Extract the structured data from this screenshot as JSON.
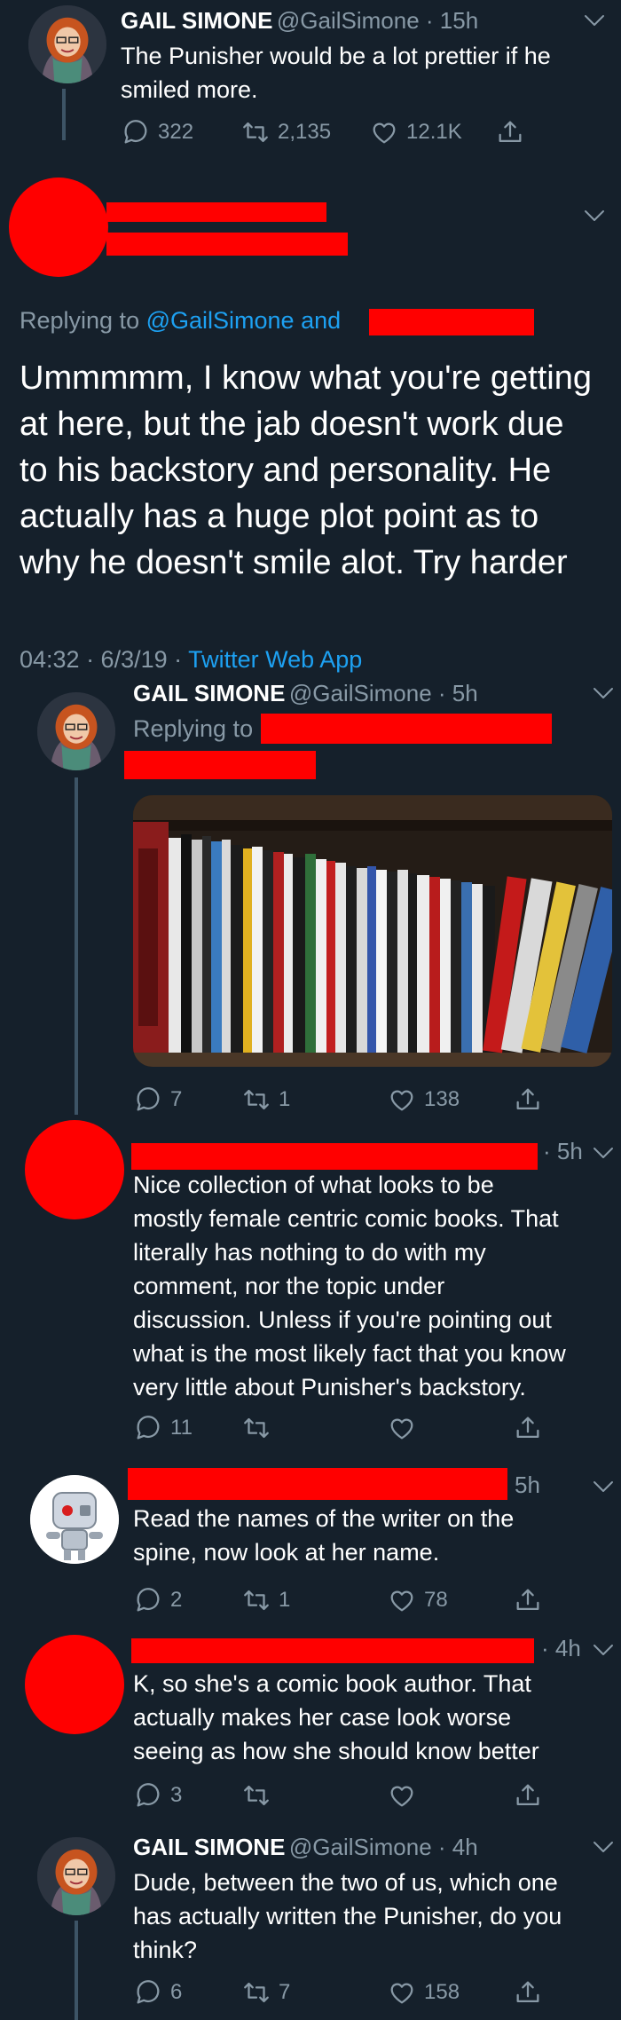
{
  "colors": {
    "background": "#15202b",
    "secondary_text": "#8899a6",
    "link": "#1da1f2",
    "redaction": "#ff0000"
  },
  "tweet1": {
    "name": "GAIL SIMONE",
    "handle_time": "@GailSimone · 15h",
    "text_line1": "The Punisher would be a lot prettier if he",
    "text_line2": "smiled more.",
    "replies": "322",
    "retweets": "2,135",
    "likes": "12.1K"
  },
  "tweet2": {
    "replying_prefix": "Replying to ",
    "replying_handle": "@GailSimone and",
    "lines": [
      "Ummmmm, I know what you're getting",
      "at here, but the jab doesn't work due",
      "to his backstory and personality. He",
      "actually has a huge plot point as to",
      "why he doesn't smile alot. Try harder"
    ],
    "timestamp": "04:32 · 6/3/19 · ",
    "client": "Twitter Web App"
  },
  "tweet3": {
    "name": "GAIL SIMONE",
    "handle_time": "@GailSimone · 5h",
    "replying_prefix": "Replying to",
    "replies": "7",
    "retweets": "1",
    "likes": "138"
  },
  "tweet4": {
    "time": "· 5h",
    "lines": [
      "Nice collection of what looks to be",
      "mostly female centric comic books. That",
      "literally has nothing to do with my",
      "comment, nor the topic under",
      "discussion. Unless if you're pointing out",
      "what is the most likely fact that you know",
      "very little about Punisher's backstory."
    ],
    "replies": "11"
  },
  "tweet5": {
    "time": "5h",
    "lines": [
      "Read the names of the writer on the",
      "spine, now look at her name."
    ],
    "replies": "2",
    "retweets": "1",
    "likes": "78"
  },
  "tweet6": {
    "time": "· 4h",
    "lines": [
      "K, so she's a comic book author. That",
      "actually makes her case look worse",
      "seeing as how she should know better"
    ],
    "replies": "3"
  },
  "tweet7": {
    "name": "GAIL SIMONE",
    "handle_time": "@GailSimone · 4h",
    "lines": [
      "Dude, between the two of us, which one",
      "has actually written the Punisher, do you",
      "think?"
    ],
    "replies": "6",
    "retweets": "7",
    "likes": "158"
  },
  "icons": {
    "reply": "reply-icon",
    "retweet": "retweet-icon",
    "like": "heart-icon",
    "share": "share-icon",
    "more": "chevron-down-icon"
  }
}
